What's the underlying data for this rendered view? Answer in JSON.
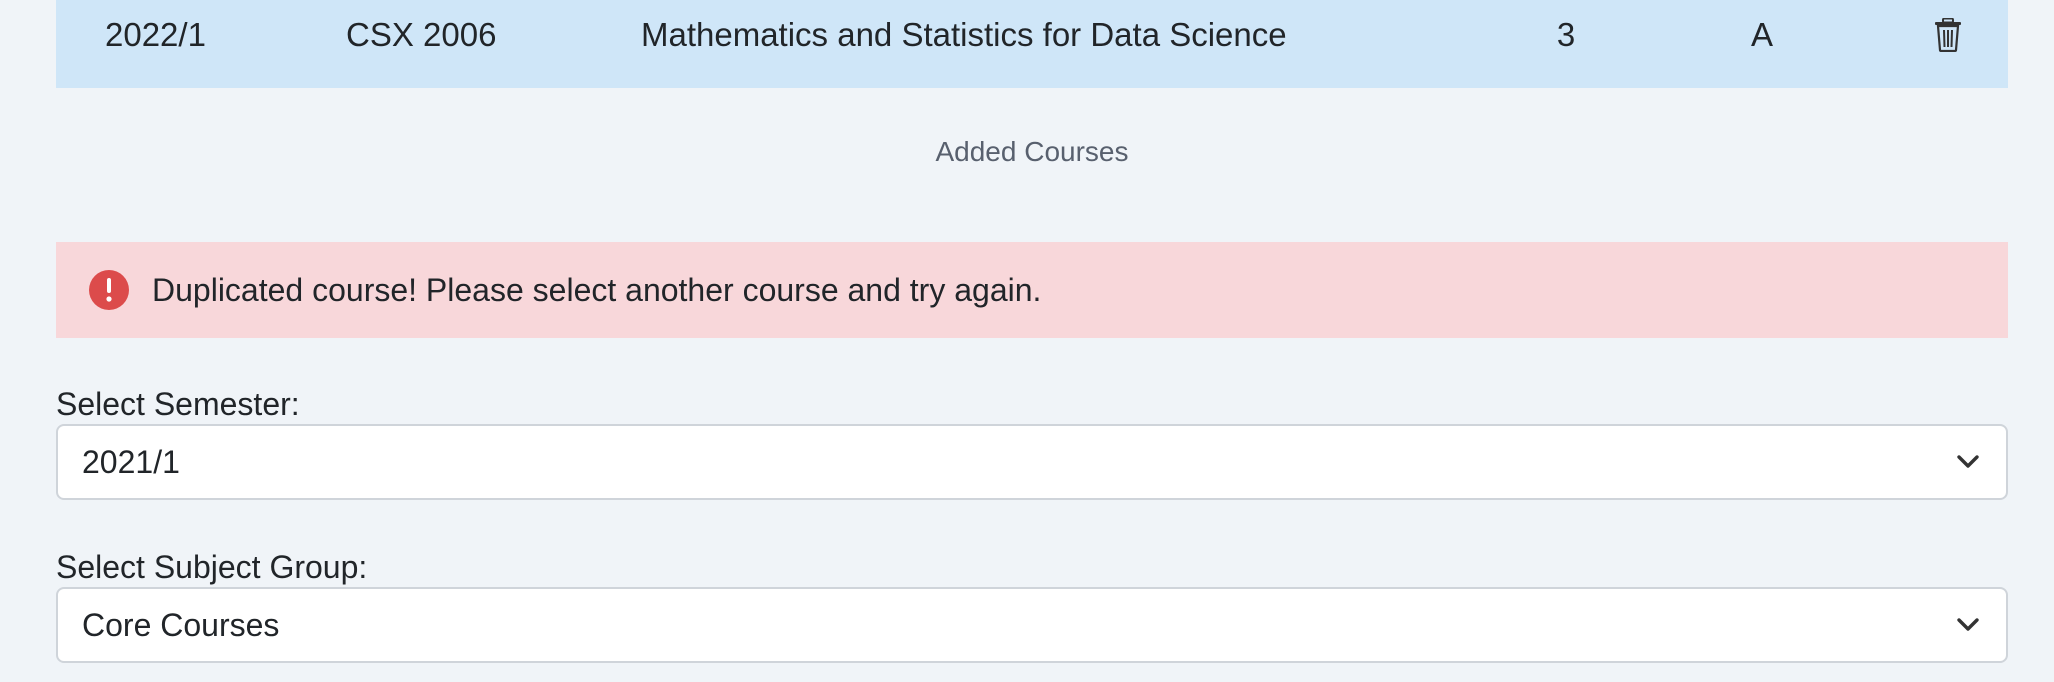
{
  "course_row": {
    "semester": "2022/1",
    "code": "CSX 2006",
    "name": "Mathematics and Statistics for Data Science",
    "credits": "3",
    "grade": "A",
    "delete_icon": "trash-icon"
  },
  "caption": "Added Courses",
  "alert": {
    "icon": "exclamation-circle-icon",
    "message": "Duplicated course! Please select another course and try again.",
    "color": "#dc3545",
    "background": "#f8d7da"
  },
  "semester_field": {
    "label": "Select Semester:",
    "value": "2021/1"
  },
  "subject_group_field": {
    "label": "Select Subject Group:",
    "value": "Core Courses"
  },
  "colors": {
    "row_highlight": "#cfe6f8",
    "page_background": "#f0f4f8"
  }
}
